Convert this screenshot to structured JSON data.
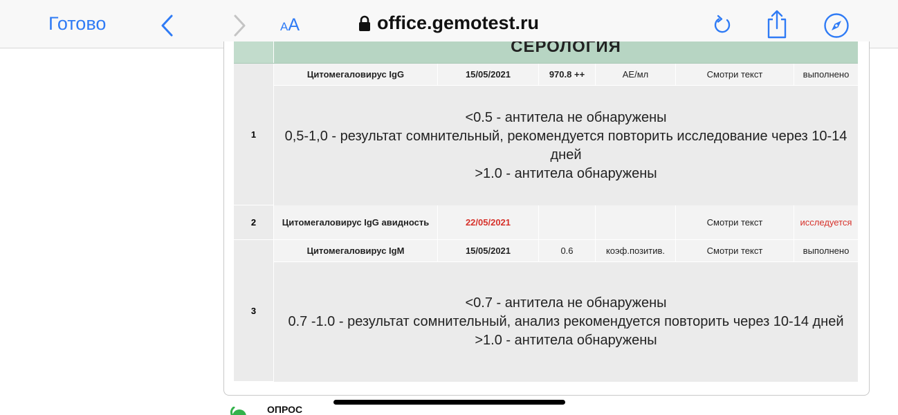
{
  "browser": {
    "done_label": "Готово",
    "text_size_small": "A",
    "text_size_big": "A",
    "url": "office.gemotest.ru",
    "accent_color": "#2f7bf5"
  },
  "section": {
    "title": "СЕРОЛОГИЯ"
  },
  "rows": [
    {
      "number": "1",
      "name": "Цитомегаловирус IgG",
      "date": "15/05/2021",
      "value": "970.8 ++",
      "unit": "АЕ/мл",
      "norm": "Смотри текст",
      "status": "выполнено",
      "note_lines": [
        "<0.5 - антитела не обнаружены",
        "0,5-1,0 - результат сомнительный, рекомендуется повторить исследование через 10-14 дней",
        ">1.0 - антитела обнаружены"
      ]
    },
    {
      "number": "2",
      "name": "Цитомегаловирус IgG авидность",
      "date": "22/05/2021",
      "value": "",
      "unit": "",
      "norm": "Смотри текст",
      "status": "исследуется"
    },
    {
      "number": "3",
      "name": "Цитомегаловирус IgM",
      "date": "15/05/2021",
      "value": "0.6",
      "unit": "коэф.позитив.",
      "norm": "Смотри текст",
      "status": "выполнено",
      "note_lines": [
        "<0.7 - антитела не обнаружены",
        "0.7 -1.0 - результат сомнительный, анализ рекомендуется повторить через 10-14 дней",
        ">1.0 - антитела обнаружены"
      ]
    }
  ],
  "footer": {
    "survey_label": "ОПРОС"
  },
  "colors": {
    "section_bg": "#b7d5c3",
    "pending_red": "#d6312a"
  }
}
